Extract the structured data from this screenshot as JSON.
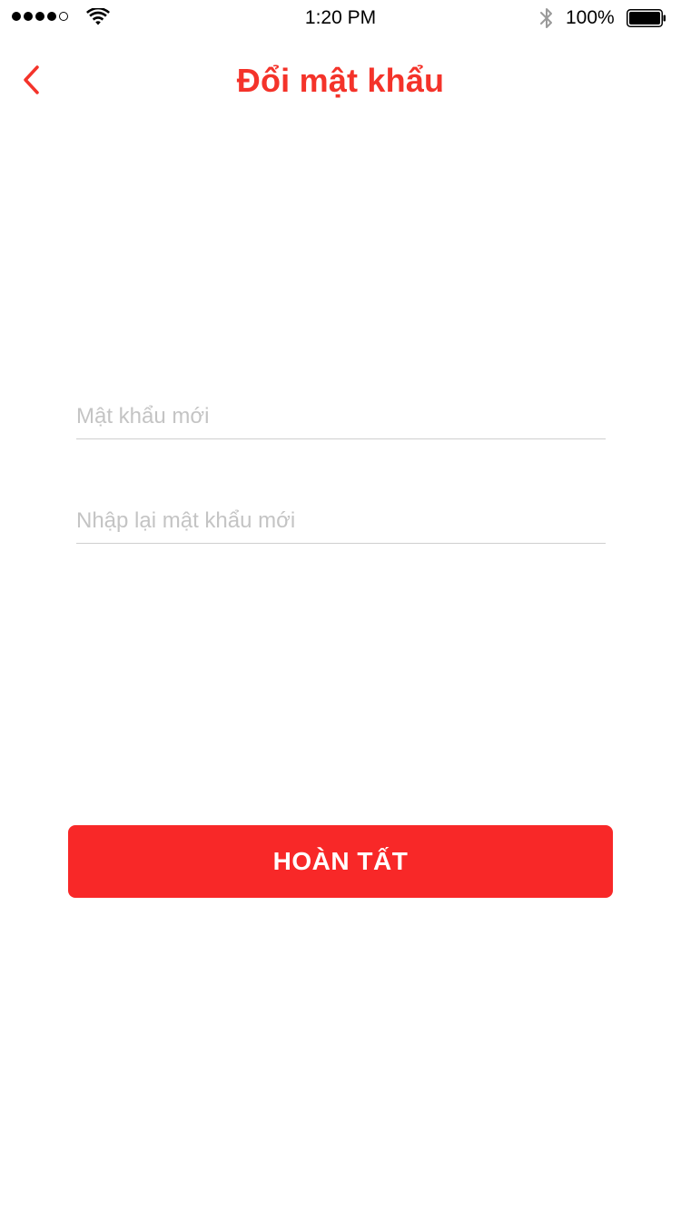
{
  "status_bar": {
    "time": "1:20 PM",
    "battery_percent": "100%",
    "signal_strength": 4,
    "signal_max": 5
  },
  "nav": {
    "title": "Đổi mật khẩu",
    "back_icon": "chevron-left-icon"
  },
  "form": {
    "new_password": {
      "placeholder": "Mật khẩu mới",
      "value": ""
    },
    "confirm_password": {
      "placeholder": "Nhập lại mật khẩu mới",
      "value": ""
    }
  },
  "submit": {
    "label": "HOÀN TẤT"
  },
  "colors": {
    "accent": "#f4332a",
    "button": "#f82828",
    "placeholder": "#c4c4c4",
    "divider": "#cfcfcf"
  }
}
